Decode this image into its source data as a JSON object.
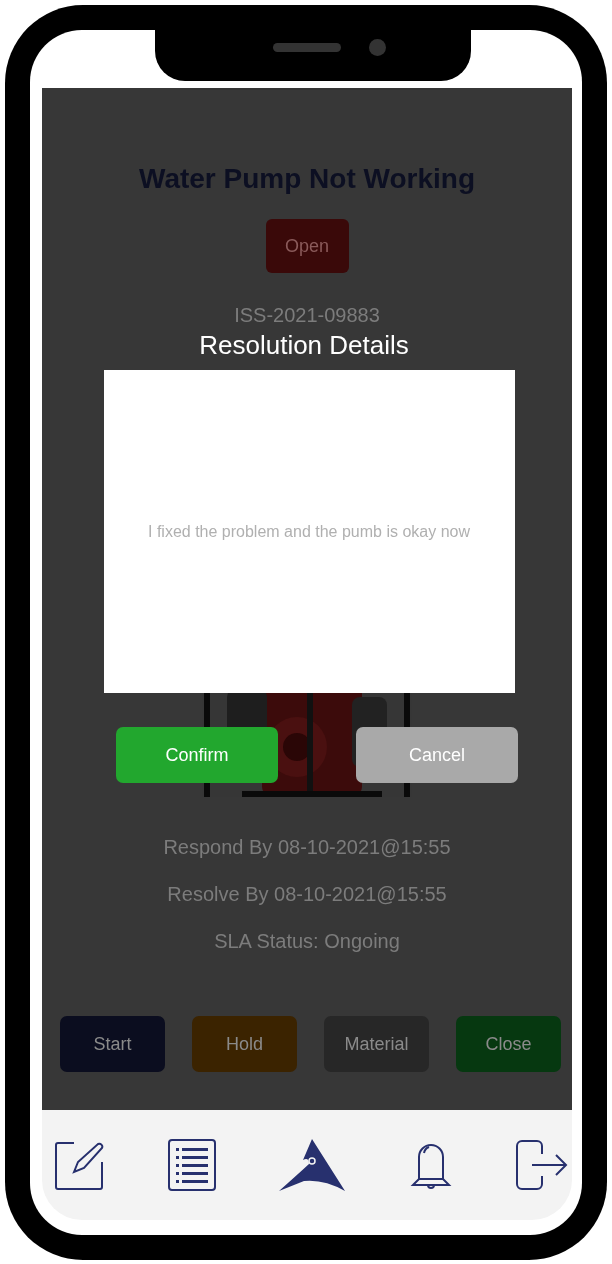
{
  "issue": {
    "title": "Water Pump Not Working",
    "status": "Open",
    "ticket": "ISS-2021-09883",
    "image": {
      "kind": "picture"
    },
    "deadlines": [
      "Respond By 08-10-2021@15:55",
      "Resolve By 08-10-2021@15:55",
      "SLA Status: Ongoing"
    ],
    "actions": [
      {
        "label": "Start",
        "color": "#0b0d1f"
      },
      {
        "label": "Hold",
        "color": "#3b2300"
      },
      {
        "label": "Material",
        "color": "#272727"
      },
      {
        "label": "Close",
        "color": "#063810"
      }
    ]
  },
  "dialog": {
    "title": "Resolution Details",
    "value": "I fixed the problem and the pumb is okay now",
    "buttons": [
      {
        "label": "Confirm",
        "kind": "primary"
      },
      {
        "label": "Cancel",
        "kind": "secondary"
      }
    ]
  }
}
